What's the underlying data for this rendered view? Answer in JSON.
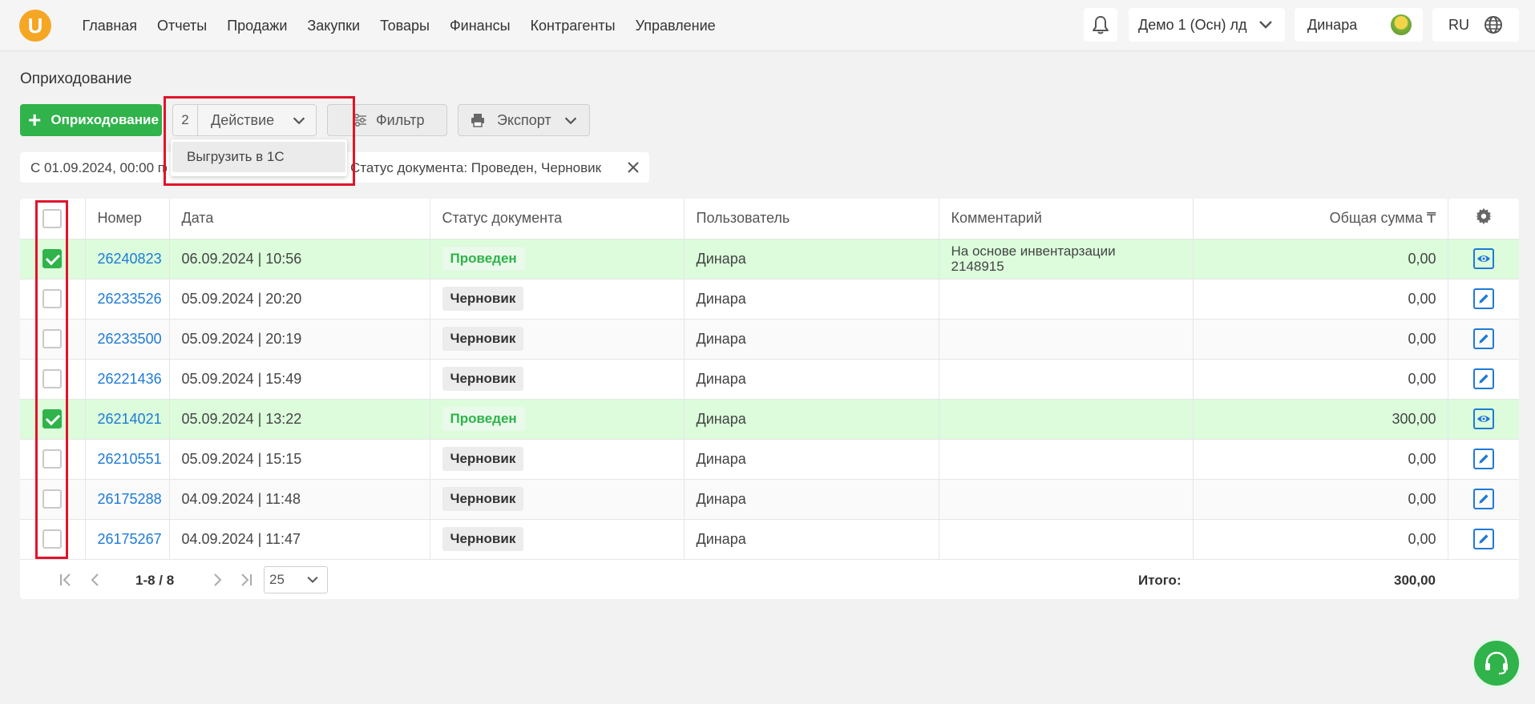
{
  "header": {
    "logo_letter": "U",
    "nav": [
      "Главная",
      "Отчеты",
      "Продажи",
      "Закупки",
      "Товары",
      "Финансы",
      "Контрагенты",
      "Управление"
    ],
    "company": "Демо 1 (Осн) лд",
    "user": "Динара",
    "lang": "RU"
  },
  "page": {
    "title": "Оприходование"
  },
  "toolbar": {
    "add_label": "Оприходование",
    "action_count": "2",
    "action_label": "Действие",
    "filter_label": "Фильтр",
    "export_label": "Экспорт"
  },
  "dropdown": {
    "item": "Выгрузить в 1С"
  },
  "filters": {
    "date": "С 01.09.2024, 00:00 по",
    "status": "Статус документа: Проведен, Черновик"
  },
  "table": {
    "columns": {
      "number": "Номер",
      "date": "Дата",
      "status": "Статус документа",
      "user": "Пользователь",
      "comment": "Комментарий",
      "total": "Общая сумма ₸"
    },
    "rows": [
      {
        "checked": true,
        "number": "26240823",
        "date": "06.09.2024 | 10:56",
        "status": "Проведен",
        "status_type": "ok",
        "user": "Динара",
        "comment": "На основе инвентарзации 2148915",
        "total": "0,00",
        "action": "view"
      },
      {
        "checked": false,
        "number": "26233526",
        "date": "05.09.2024 | 20:20",
        "status": "Черновик",
        "status_type": "draft",
        "user": "Динара",
        "comment": "",
        "total": "0,00",
        "action": "edit"
      },
      {
        "checked": false,
        "number": "26233500",
        "date": "05.09.2024 | 20:19",
        "status": "Черновик",
        "status_type": "draft",
        "user": "Динара",
        "comment": "",
        "total": "0,00",
        "action": "edit"
      },
      {
        "checked": false,
        "number": "26221436",
        "date": "05.09.2024 | 15:49",
        "status": "Черновик",
        "status_type": "draft",
        "user": "Динара",
        "comment": "",
        "total": "0,00",
        "action": "edit"
      },
      {
        "checked": true,
        "number": "26214021",
        "date": "05.09.2024 | 13:22",
        "status": "Проведен",
        "status_type": "ok",
        "user": "Динара",
        "comment": "",
        "total": "300,00",
        "action": "view"
      },
      {
        "checked": false,
        "number": "26210551",
        "date": "05.09.2024 | 15:15",
        "status": "Черновик",
        "status_type": "draft",
        "user": "Динара",
        "comment": "",
        "total": "0,00",
        "action": "edit"
      },
      {
        "checked": false,
        "number": "26175288",
        "date": "04.09.2024 | 11:48",
        "status": "Черновик",
        "status_type": "draft",
        "user": "Динара",
        "comment": "",
        "total": "0,00",
        "action": "edit"
      },
      {
        "checked": false,
        "number": "26175267",
        "date": "04.09.2024 | 11:47",
        "status": "Черновик",
        "status_type": "draft",
        "user": "Динара",
        "comment": "",
        "total": "0,00",
        "action": "edit"
      }
    ]
  },
  "pager": {
    "range": "1-8 / 8",
    "page_size": "25",
    "total_label": "Итого:",
    "total_value": "300,00"
  },
  "colors": {
    "accent": "#2fb34a",
    "link": "#1e7ad6",
    "selected_row": "#dcfcdc",
    "highlight": "#e0142a"
  }
}
